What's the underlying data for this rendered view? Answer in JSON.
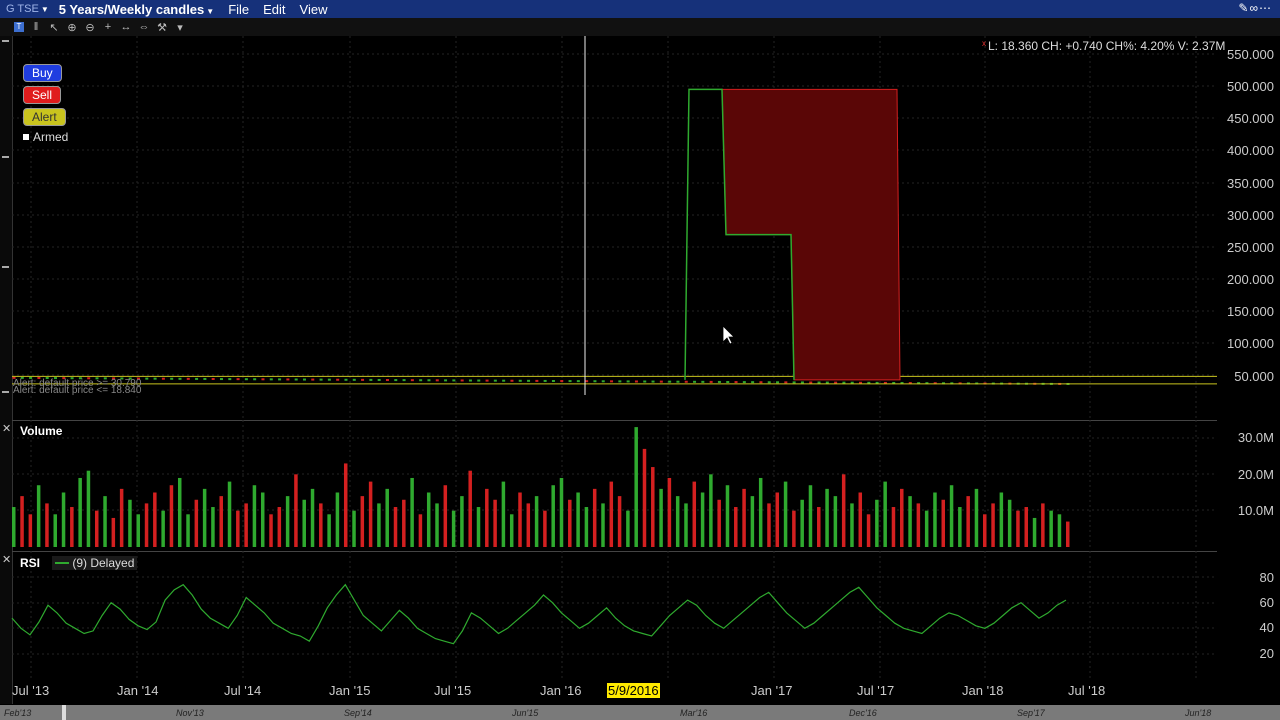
{
  "window": {
    "ticker": "G",
    "exchange": "TSE",
    "timeframe": "5 Years/Weekly candles",
    "menu": [
      "File",
      "Edit",
      "View"
    ]
  },
  "actions": {
    "buy": "Buy",
    "sell": "Sell",
    "alert": "Alert",
    "armed": "Armed"
  },
  "quote_info": "L: 18.360 CH: +0.740 CH%: 4.20% V: 2.37M",
  "alert_labels": [
    "Alert: default price >= 30.790",
    "Alert: default price <= 18.840"
  ],
  "price_axis": [
    "550.000",
    "500.000",
    "450.000",
    "400.000",
    "350.000",
    "300.000",
    "250.000",
    "200.000",
    "150.000",
    "100.000",
    "50.000"
  ],
  "volume": {
    "title": "Volume",
    "axis": [
      "30.0M",
      "20.0M",
      "10.0M"
    ]
  },
  "rsi": {
    "title": "RSI",
    "legend": "(9) Delayed",
    "axis": [
      "80",
      "60",
      "40",
      "20"
    ]
  },
  "x_axis": [
    "Jul '13",
    "Jan '14",
    "Jul '14",
    "Jan '15",
    "Jul '15",
    "Jan '16",
    "5/9/2016",
    "Jan '17",
    "Jul '17",
    "Jan '18",
    "Jul '18"
  ],
  "navigator": [
    "Feb'13",
    "Nov'13",
    "Sep'14",
    "Jun'15",
    "Mar'16",
    "Dec'16",
    "Sep'17",
    "Jun'18"
  ],
  "colors": {
    "up": "#2faa2f",
    "down": "#d42020",
    "spike_fill": "#5a0606",
    "title_bar": "#16317a"
  },
  "chart_data": {
    "type": "bar",
    "price": {
      "band": [
        18.36,
        30.79
      ],
      "spike_high": 505,
      "spike_plateau": 265,
      "ylim": [
        0,
        570
      ]
    },
    "volume_M": [
      11,
      14,
      9,
      17,
      12,
      9,
      15,
      11,
      19,
      21,
      10,
      14,
      8,
      16,
      13,
      9,
      12,
      15,
      10,
      17,
      19,
      9,
      13,
      16,
      11,
      14,
      18,
      10,
      12,
      17,
      15,
      9,
      11,
      14,
      20,
      13,
      16,
      12,
      9,
      15,
      23,
      10,
      14,
      18,
      12,
      16,
      11,
      13,
      19,
      9,
      15,
      12,
      17,
      10,
      14,
      21,
      11,
      16,
      13,
      18,
      9,
      15,
      12,
      14,
      10,
      17,
      19,
      13,
      15,
      11,
      16,
      12,
      18,
      14,
      10,
      33,
      27,
      22,
      16,
      19,
      14,
      12,
      18,
      15,
      20,
      13,
      17,
      11,
      16,
      14,
      19,
      12,
      15,
      18,
      10,
      13,
      17,
      11,
      16,
      14,
      20,
      12,
      15,
      9,
      13,
      18,
      11,
      16,
      14,
      12,
      10,
      15,
      13,
      17,
      11,
      14,
      16,
      9,
      12,
      15,
      13,
      10,
      11,
      8,
      12,
      10,
      9,
      7
    ],
    "rsi": [
      48,
      40,
      35,
      45,
      58,
      52,
      44,
      40,
      36,
      38,
      50,
      60,
      55,
      47,
      42,
      39,
      45,
      62,
      70,
      74,
      66,
      55,
      48,
      44,
      40,
      50,
      64,
      58,
      52,
      44,
      40,
      36,
      34,
      30,
      42,
      56,
      66,
      74,
      62,
      50,
      44,
      38,
      46,
      54,
      48,
      40,
      36,
      32,
      30,
      28,
      38,
      52,
      48,
      42,
      36,
      40,
      46,
      52,
      58,
      66,
      60,
      52,
      46,
      40,
      44,
      50,
      56,
      48,
      42,
      38,
      36,
      34,
      42,
      50,
      56,
      62,
      58,
      50,
      44,
      40,
      46,
      52,
      58,
      64,
      68,
      60,
      52,
      46,
      40,
      44,
      50,
      56,
      62,
      68,
      72,
      64,
      56,
      50,
      44,
      40,
      38,
      36,
      42,
      48,
      52,
      50,
      46,
      42,
      40,
      44,
      50,
      56,
      60,
      54,
      48,
      52,
      58,
      62
    ],
    "ylabel": ""
  }
}
